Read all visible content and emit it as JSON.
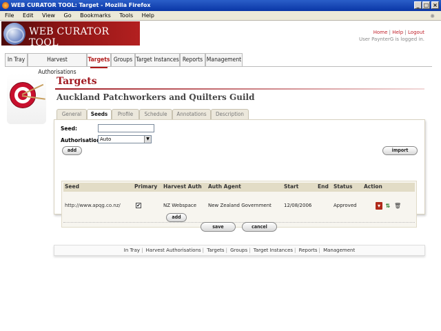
{
  "window": {
    "title": "WEB CURATOR TOOL: Target - Mozilla Firefox"
  },
  "menu": [
    "File",
    "Edit",
    "View",
    "Go",
    "Bookmarks",
    "Tools",
    "Help"
  ],
  "header": {
    "logo_text": "WEB CURATOR TOOL",
    "links": [
      "Home",
      "Help",
      "Logout"
    ],
    "user_text": "User PaynterG is logged in."
  },
  "nav": [
    "In Tray",
    "Harvest Authorisations",
    "Targets",
    "Groups",
    "Target Instances",
    "Reports",
    "Management"
  ],
  "nav_active": "Targets",
  "page": {
    "title": "Targets",
    "target_name": "Auckland Patchworkers and Quilters Guild"
  },
  "subtabs": [
    "General",
    "Seeds",
    "Profile",
    "Schedule",
    "Annotations",
    "Description"
  ],
  "subtab_active": "Seeds",
  "form": {
    "seed_label": "Seed:",
    "seed_value": "",
    "authorisation_label": "Authorisation:",
    "authorisation_value": "Auto",
    "add_label": "add",
    "import_label": "import"
  },
  "seeds_table": {
    "columns": [
      "Seed",
      "Primary",
      "Harvest Auth",
      "Auth Agent",
      "Start",
      "End",
      "Status",
      "Action"
    ],
    "rows": [
      {
        "seed": "http://www.apqg.co.nz/",
        "primary": true,
        "harvest_auth": "NZ Webspace",
        "auth_agent": "New Zealand Government",
        "start": "12/08/2006",
        "end": "",
        "status": "Approved"
      }
    ],
    "add_label": "add"
  },
  "buttons": {
    "save": "save",
    "cancel": "cancel"
  },
  "footer_links": [
    "In Tray",
    "Harvest Authorisations",
    "Targets",
    "Groups",
    "Target Instances",
    "Reports",
    "Management"
  ],
  "colors": {
    "accent": "#a01820",
    "link": "#c0202a",
    "titlebar": "#0a36a6"
  }
}
